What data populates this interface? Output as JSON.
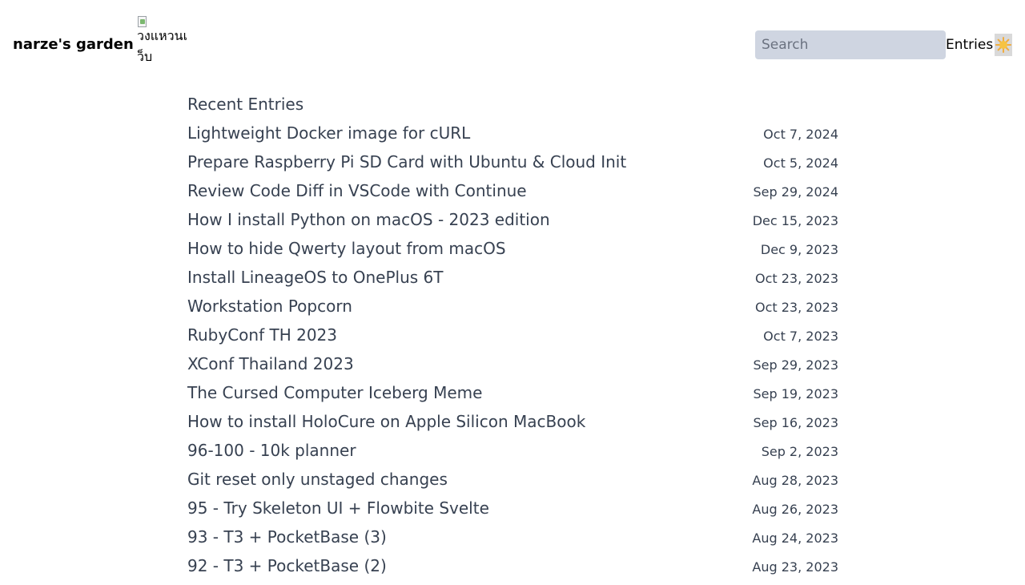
{
  "header": {
    "site_title": "narze's garden",
    "webring_alt": "วงแหวนเว็บ",
    "search_placeholder": "Search",
    "search_value": "",
    "nav_entries": "Entries",
    "theme_icon": "sun-icon"
  },
  "main": {
    "section_title": "Recent Entries",
    "entries": [
      {
        "title": "Lightweight Docker image for cURL",
        "date": "Oct 7, 2024"
      },
      {
        "title": "Prepare Raspberry Pi SD Card with Ubuntu & Cloud Init",
        "date": "Oct 5, 2024"
      },
      {
        "title": "Review Code Diff in VSCode with Continue",
        "date": "Sep 29, 2024"
      },
      {
        "title": "How I install Python on macOS - 2023 edition",
        "date": "Dec 15, 2023"
      },
      {
        "title": "How to hide Qwerty layout from macOS",
        "date": "Dec 9, 2023"
      },
      {
        "title": "Install LineageOS to OnePlus 6T",
        "date": "Oct 23, 2023"
      },
      {
        "title": "Workstation Popcorn",
        "date": "Oct 23, 2023"
      },
      {
        "title": "RubyConf TH 2023",
        "date": "Oct 7, 2023"
      },
      {
        "title": "XConf Thailand 2023",
        "date": "Sep 29, 2023"
      },
      {
        "title": "The Cursed Computer Iceberg Meme",
        "date": "Sep 19, 2023"
      },
      {
        "title": "How to install HoloCure on Apple Silicon MacBook",
        "date": "Sep 16, 2023"
      },
      {
        "title": "96-100 - 10k planner",
        "date": "Sep 2, 2023"
      },
      {
        "title": "Git reset only unstaged changes",
        "date": "Aug 28, 2023"
      },
      {
        "title": "95 - Try Skeleton UI + Flowbite Svelte",
        "date": "Aug 26, 2023"
      },
      {
        "title": "93 - T3 + PocketBase (3)",
        "date": "Aug 24, 2023"
      },
      {
        "title": "92 - T3 + PocketBase (2)",
        "date": "Aug 23, 2023"
      }
    ]
  },
  "colors": {
    "text": "#374151",
    "search_bg": "#cfd5e1",
    "toggle_bg": "#d9d9d9",
    "sun": "#f6c342"
  }
}
